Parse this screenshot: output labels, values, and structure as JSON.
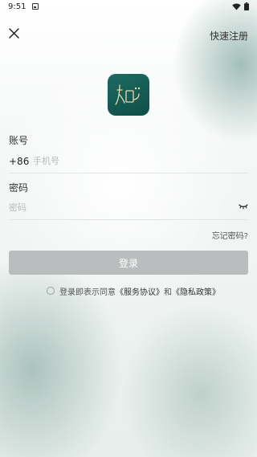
{
  "status_bar": {
    "time": "9:51"
  },
  "header": {
    "register_label": "快速注册"
  },
  "form": {
    "account_label": "账号",
    "country_code": "+86",
    "phone_placeholder": "手机号",
    "password_label": "密码",
    "password_placeholder": "密码",
    "forgot_label": "忘记密码?",
    "login_label": "登录"
  },
  "agreement": {
    "prefix": "登录即表示同意",
    "service_link": "《服务协议》",
    "connector": "和",
    "privacy_link": "《隐私政策》"
  },
  "colors": {
    "logo_bg": "#15645a",
    "login_button_disabled": "#b9bdbd"
  },
  "icons": [
    "sim-card-icon",
    "wifi-icon",
    "battery-icon",
    "close-icon",
    "app-logo-icon",
    "eye-closed-icon",
    "checkbox-icon"
  ]
}
